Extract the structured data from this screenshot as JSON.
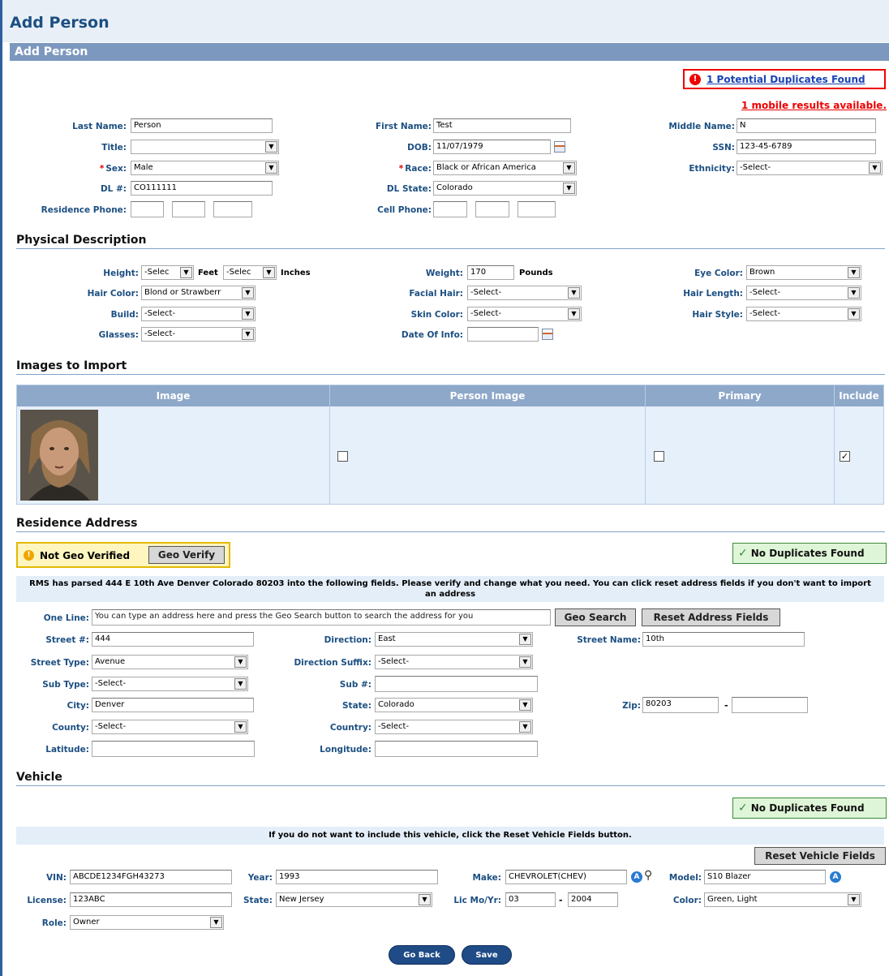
{
  "page": {
    "title": "Add Person",
    "panel_title": "Add Person"
  },
  "alerts": {
    "duplicates_link": "1 Potential Duplicates Found",
    "mobile_results": "1 mobile results available."
  },
  "person": {
    "last_name_label": "Last Name:",
    "last_name": "Person",
    "first_name_label": "First Name:",
    "first_name": "Test",
    "middle_name_label": "Middle Name:",
    "middle_name": "N",
    "title_label": "Title:",
    "title": "",
    "dob_label": "DOB:",
    "dob": "11/07/1979",
    "ssn_label": "SSN:",
    "ssn": "123-45-6789",
    "sex_label": "Sex:",
    "sex": "Male",
    "race_label": "Race:",
    "race": "Black or African America",
    "ethnicity_label": "Ethnicity:",
    "ethnicity": "-Select-",
    "dl_label": "DL #:",
    "dl": "CO111111",
    "dl_state_label": "DL State:",
    "dl_state": "Colorado",
    "res_phone_label": "Residence Phone:",
    "cell_phone_label": "Cell Phone:"
  },
  "physical": {
    "heading": "Physical Description",
    "height_label": "Height:",
    "height_feet": "-Selec",
    "feet_unit": "Feet",
    "height_inches": "-Selec",
    "inches_unit": "Inches",
    "weight_label": "Weight:",
    "weight": "170",
    "weight_unit": "Pounds",
    "eye_label": "Eye Color:",
    "eye": "Brown",
    "hair_color_label": "Hair Color:",
    "hair_color": "Blond or Strawberr",
    "facial_hair_label": "Facial Hair:",
    "facial_hair": "-Select-",
    "hair_length_label": "Hair Length:",
    "hair_length": "-Select-",
    "build_label": "Build:",
    "build": "-Select-",
    "skin_label": "Skin Color:",
    "skin": "-Select-",
    "hair_style_label": "Hair Style:",
    "hair_style": "-Select-",
    "glasses_label": "Glasses:",
    "glasses": "-Select-",
    "date_info_label": "Date Of Info:",
    "date_info": ""
  },
  "images": {
    "heading": "Images to Import",
    "columns": [
      "Image",
      "Person Image",
      "Primary",
      "Include"
    ],
    "row": {
      "person_image": false,
      "primary": false,
      "include": true
    }
  },
  "address": {
    "heading": "Residence Address",
    "geo_status": "Not Geo Verified",
    "geo_verify": "Geo Verify",
    "no_dup": "No Duplicates Found",
    "parse_msg": "RMS has parsed 444 E 10th Ave Denver Colorado 80203 into the following fields. Please verify and change what you need. You can click reset address fields if you don't want to import an address",
    "one_line_label": "One Line:",
    "one_line_placeholder": "You can type an address here and press the Geo Search button to search the address for you",
    "geo_search": "Geo Search",
    "reset_fields": "Reset Address Fields",
    "street_no_label": "Street #:",
    "street_no": "444",
    "direction_label": "Direction:",
    "direction": "East",
    "street_name_label": "Street Name:",
    "street_name": "10th",
    "street_type_label": "Street Type:",
    "street_type": "Avenue",
    "dir_suffix_label": "Direction Suffix:",
    "dir_suffix": "-Select-",
    "sub_type_label": "Sub Type:",
    "sub_type": "-Select-",
    "sub_no_label": "Sub #:",
    "sub_no": "",
    "city_label": "City:",
    "city": "Denver",
    "state_label": "State:",
    "state": "Colorado",
    "zip_label": "Zip:",
    "zip": "80203",
    "zip_sep": "-",
    "zip_ext": "",
    "county_label": "County:",
    "county": "-Select-",
    "country_label": "Country:",
    "country": "-Select-",
    "lat_label": "Latitude:",
    "lat": "",
    "lon_label": "Longitude:",
    "lon": ""
  },
  "vehicle": {
    "heading": "Vehicle",
    "no_dup": "No Duplicates Found",
    "msg": "If you do not want to include this vehicle, click the Reset Vehicle Fields button.",
    "reset": "Reset Vehicle Fields",
    "vin_label": "VIN:",
    "vin": "ABCDE1234FGH43273",
    "year_label": "Year:",
    "year": "1993",
    "make_label": "Make:",
    "make": "CHEVROLET(CHEV)",
    "model_label": "Model:",
    "model": "S10 Blazer",
    "license_label": "License:",
    "license": "123ABC",
    "state_label": "State:",
    "state": "New Jersey",
    "licmo_label": "Lic Mo/Yr:",
    "lic_mo": "03",
    "lic_sep": "-",
    "lic_yr": "2004",
    "color_label": "Color:",
    "color": "Green, Light",
    "role_label": "Role:",
    "role": "Owner"
  },
  "buttons": {
    "go_back": "Go Back",
    "save": "Save"
  },
  "colors": {
    "header_bg": "#dde7f3",
    "panel_bar": "#7d98bf",
    "title_blue": "#1c4f82",
    "accent_red": "#e00000"
  }
}
